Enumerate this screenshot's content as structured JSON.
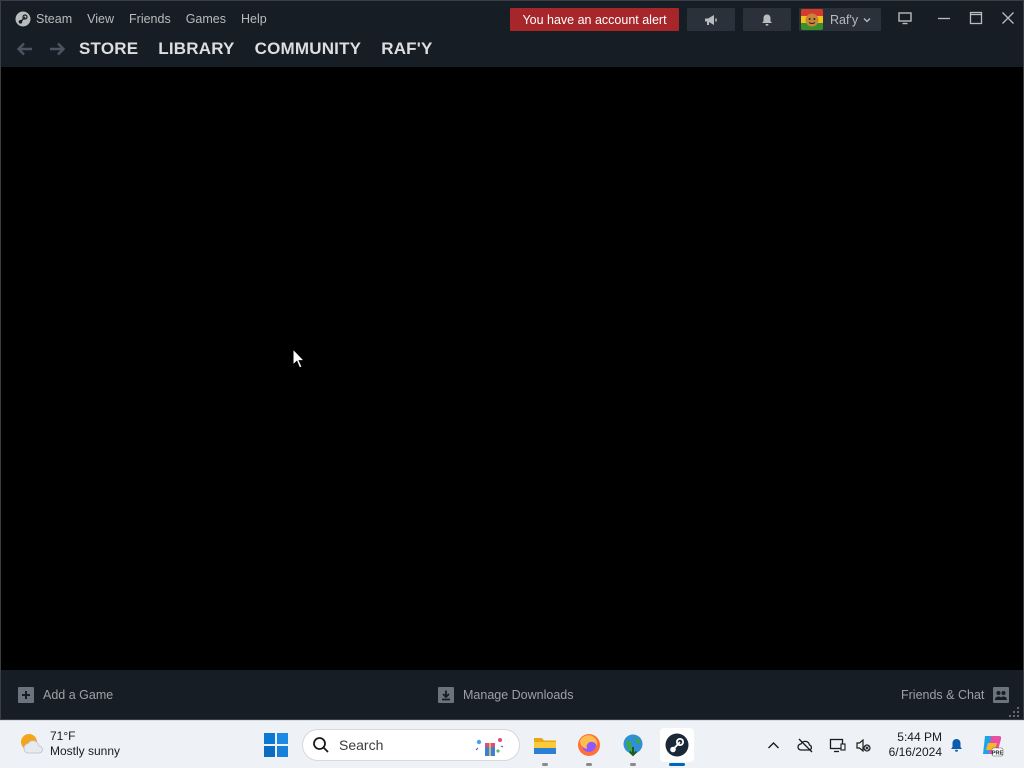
{
  "steam": {
    "menu": [
      "Steam",
      "View",
      "Friends",
      "Games",
      "Help"
    ],
    "nav_tabs": [
      "STORE",
      "LIBRARY",
      "COMMUNITY",
      "RAF'Y"
    ],
    "alert_label": "You have an account alert",
    "account_name": "Raf'y",
    "bottom": {
      "add_game": "Add a Game",
      "manage_downloads": "Manage Downloads",
      "friends_chat": "Friends & Chat"
    },
    "colors": {
      "alert": "#a6262a",
      "chrome": "#171d25",
      "button": "#2a313b",
      "text": "#b8bcbf"
    }
  },
  "taskbar": {
    "weather": {
      "temp": "71°F",
      "condition": "Mostly sunny",
      "icon": "sun-cloud-icon"
    },
    "search_placeholder": "Search",
    "apps": [
      {
        "name": "File Explorer",
        "icon": "folder-icon",
        "state": "running"
      },
      {
        "name": "Firefox",
        "icon": "firefox-icon",
        "state": "running"
      },
      {
        "name": "Internet Download Manager",
        "icon": "idm-globe-icon",
        "state": "running"
      },
      {
        "name": "Steam",
        "icon": "steam-icon",
        "state": "focused"
      }
    ],
    "tray": [
      "chevron-up-icon",
      "onedrive-offline-icon",
      "display-icon",
      "network-volume-icon"
    ],
    "time": "5:44 PM",
    "date": "6/16/2024"
  }
}
